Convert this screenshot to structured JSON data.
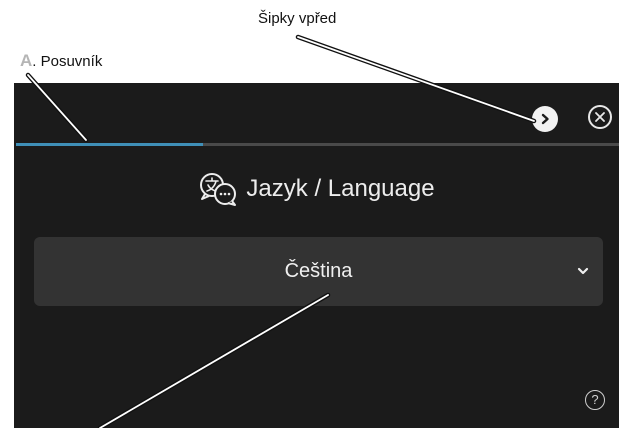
{
  "annotations": {
    "arrows_label": "Šipky vpřed",
    "slider_letter": "A",
    "slider_label": ". Posuvník"
  },
  "screen": {
    "progress_fraction": 0.31,
    "title": "Jazyk /  Language",
    "language_dropdown": {
      "selected": "Čeština"
    },
    "help_label": "?"
  },
  "icons": {
    "forward": "chevron-right-circle-icon",
    "close": "close-circle-icon",
    "language": "language-translate-icon",
    "dropdown": "chevron-down-icon",
    "help": "help-circle-icon"
  },
  "colors": {
    "background": "#1b1b1b",
    "progress_fill": "#3f8fb8",
    "dropdown_bg": "#333333"
  }
}
